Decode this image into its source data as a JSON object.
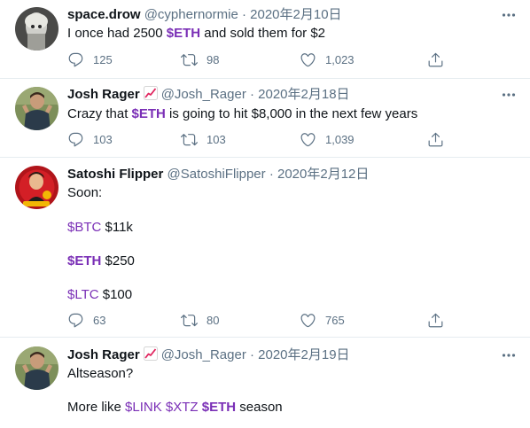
{
  "tweets": [
    {
      "name": "space.drow",
      "handle": "@cyphernormie",
      "sep": "·",
      "date": "2020年2月10日",
      "lines": [
        [
          {
            "t": "I once had 2500 "
          },
          {
            "t": "$ETH",
            "tag": true,
            "bold": true
          },
          {
            "t": " and sold them for $2"
          }
        ]
      ],
      "replies": "125",
      "retweets": "98",
      "likes": "1,023"
    },
    {
      "name": "Josh Rager",
      "badge": "chart-increasing-emoji",
      "handle": "@Josh_Rager",
      "sep": "·",
      "date": "2020年2月18日",
      "lines": [
        [
          {
            "t": "Crazy that "
          },
          {
            "t": "$ETH",
            "tag": true,
            "bold": true
          },
          {
            "t": " is going to hit $8,000 in the next few years"
          }
        ]
      ],
      "replies": "103",
      "retweets": "103",
      "likes": "1,039"
    },
    {
      "name": "Satoshi Flipper",
      "handle": "@SatoshiFlipper",
      "sep": "·",
      "date": "2020年2月12日",
      "lines": [
        [
          {
            "t": "Soon:"
          }
        ],
        [
          {
            "t": "$BTC",
            "tag": true
          },
          {
            "t": " $11k"
          }
        ],
        [
          {
            "t": "$ETH",
            "tag": true,
            "bold": true
          },
          {
            "t": " $250"
          }
        ],
        [
          {
            "t": "$LTC",
            "tag": true
          },
          {
            "t": " $100"
          }
        ]
      ],
      "replies": "63",
      "retweets": "80",
      "likes": "765"
    },
    {
      "name": "Josh Rager",
      "badge": "chart-increasing-emoji",
      "handle": "@Josh_Rager",
      "sep": "·",
      "date": "2020年2月19日",
      "lines": [
        [
          {
            "t": "Altseason?"
          }
        ],
        [
          {
            "t": "More like "
          },
          {
            "t": "$LINK",
            "tag": true
          },
          {
            "t": " "
          },
          {
            "t": "$XTZ",
            "tag": true
          },
          {
            "t": " "
          },
          {
            "t": "$ETH",
            "tag": true,
            "bold": true
          },
          {
            "t": " season"
          }
        ]
      ]
    }
  ],
  "icons": {
    "reply": "reply-icon",
    "retweet": "retweet-icon",
    "like": "heart-icon",
    "share": "share-icon",
    "more": "more-icon"
  },
  "colors": {
    "cashtag": "#7a2fb6",
    "secondary": "#5b7083",
    "divider": "#e6ecf0"
  }
}
